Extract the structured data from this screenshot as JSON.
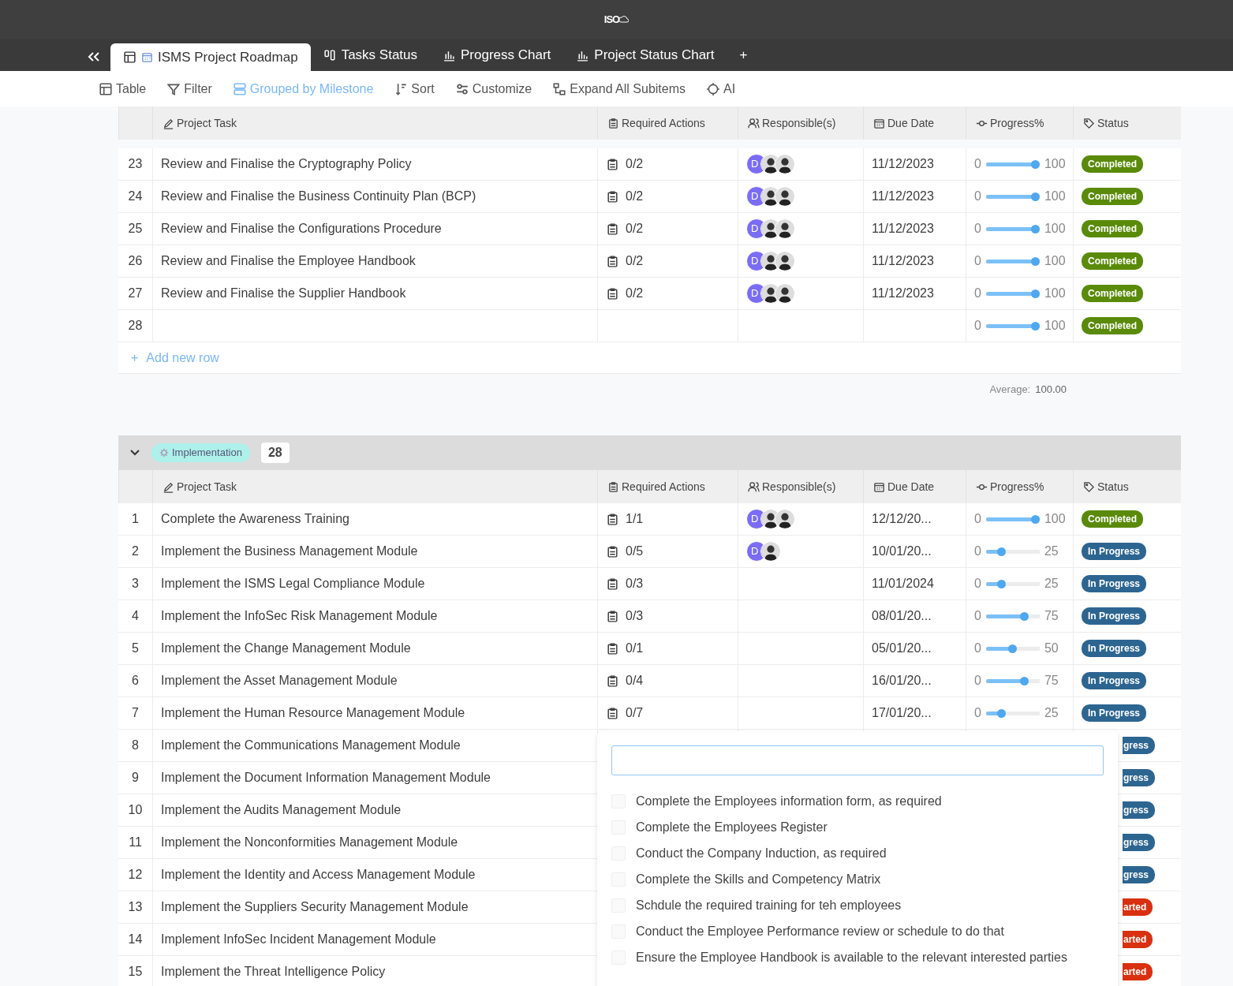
{
  "app": {
    "logo": "ISO"
  },
  "tabs": [
    {
      "label": "ISMS Project Roadmap",
      "selected": true
    },
    {
      "label": "Tasks Status",
      "selected": false
    },
    {
      "label": "Progress Chart",
      "selected": false
    },
    {
      "label": "Project Status Chart",
      "selected": false
    }
  ],
  "add_tab": "+",
  "toolbar": [
    {
      "label": "Table",
      "active": false
    },
    {
      "label": "Filter",
      "active": false
    },
    {
      "label": "Grouped by Milestone",
      "active": true
    },
    {
      "label": "Sort",
      "active": false
    },
    {
      "label": "Customize",
      "active": false
    },
    {
      "label": "Expand All Subitems",
      "active": false
    },
    {
      "label": "AI",
      "active": false
    }
  ],
  "groups": [
    {
      "columns": [
        "Project Task",
        "Required Actions",
        "Responsible(s)",
        "Due Date",
        "Progress%",
        "Status"
      ],
      "rows": [
        {
          "num": "23",
          "task": "Review and Finalise the Cryptography Policy",
          "actions": "0/2",
          "people": [
            {
              "kind": "initials",
              "text": "D"
            },
            {
              "kind": "photo"
            },
            {
              "kind": "photo"
            }
          ],
          "due": "11/12/2023",
          "min": "0",
          "level": 1.0,
          "value": "100",
          "status": {
            "text": "Completed",
            "color": "#5a8a0a",
            "cut": false
          }
        },
        {
          "num": "24",
          "task": "Review and Finalise the Business Continuity Plan (BCP)",
          "actions": "0/2",
          "people": [
            {
              "kind": "initials",
              "text": "D"
            },
            {
              "kind": "photo"
            },
            {
              "kind": "photo"
            }
          ],
          "due": "11/12/2023",
          "min": "0",
          "level": 1.0,
          "value": "100",
          "status": {
            "text": "Completed",
            "color": "#5a8a0a",
            "cut": false
          }
        },
        {
          "num": "25",
          "task": "Review and Finalise the Configurations Procedure",
          "actions": "0/2",
          "people": [
            {
              "kind": "initials",
              "text": "D"
            },
            {
              "kind": "photo"
            },
            {
              "kind": "photo"
            }
          ],
          "due": "11/12/2023",
          "min": "0",
          "level": 1.0,
          "value": "100",
          "status": {
            "text": "Completed",
            "color": "#5a8a0a",
            "cut": false
          }
        },
        {
          "num": "26",
          "task": "Review and Finalise the Employee Handbook",
          "actions": "0/2",
          "people": [
            {
              "kind": "initials",
              "text": "D"
            },
            {
              "kind": "photo"
            },
            {
              "kind": "photo"
            }
          ],
          "due": "11/12/2023",
          "min": "0",
          "level": 1.0,
          "value": "100",
          "status": {
            "text": "Completed",
            "color": "#5a8a0a",
            "cut": false
          }
        },
        {
          "num": "27",
          "task": "Review and Finalise the Supplier Handbook",
          "actions": "0/2",
          "people": [
            {
              "kind": "initials",
              "text": "D"
            },
            {
              "kind": "photo"
            },
            {
              "kind": "photo"
            }
          ],
          "due": "11/12/2023",
          "min": "0",
          "level": 1.0,
          "value": "100",
          "status": {
            "text": "Completed",
            "color": "#5a8a0a",
            "cut": false
          }
        },
        {
          "num": "28",
          "min": "0",
          "level": 1.0,
          "value": "100",
          "status": {
            "text": "Completed",
            "color": "#5a8a0a",
            "cut": false
          }
        }
      ],
      "add_icon": "+",
      "add_row": "Add new row",
      "average_label": "Average:",
      "average": "100.00"
    },
    {
      "label": "Implementation",
      "count": "28",
      "expanded": true,
      "columns": [
        "Project Task",
        "Required Actions",
        "Responsible(s)",
        "Due Date",
        "Progress%",
        "Status"
      ],
      "rows": [
        {
          "num": "1",
          "task": "Complete the Awareness Training",
          "actions": "1/1",
          "people": [
            {
              "kind": "initials",
              "text": "D"
            },
            {
              "kind": "photo"
            },
            {
              "kind": "photo"
            }
          ],
          "due": "12/12/20...",
          "min": "0",
          "level": 1.0,
          "value": "100",
          "status": {
            "text": "Completed",
            "color": "#5a8a0a",
            "cut": false
          }
        },
        {
          "num": "2",
          "task": "Implement the Business Management Module",
          "actions": "0/5",
          "people": [
            {
              "kind": "initials",
              "text": "D"
            },
            {
              "kind": "photo"
            }
          ],
          "due": "10/01/20...",
          "min": "0",
          "level": 0.25,
          "value": "25",
          "status": {
            "text": "In Progress",
            "color": "#2d6591",
            "cut": false
          }
        },
        {
          "num": "3",
          "task": "Implement the ISMS Legal Compliance Module",
          "actions": "0/3",
          "due": "11/01/2024",
          "min": "0",
          "level": 0.25,
          "value": "25",
          "status": {
            "text": "In Progress",
            "color": "#2d6591",
            "cut": false
          }
        },
        {
          "num": "4",
          "task": "Implement the InfoSec Risk Management Module",
          "actions": "0/3",
          "due": "08/01/20...",
          "min": "0",
          "level": 0.75,
          "value": "75",
          "status": {
            "text": "In Progress",
            "color": "#2d6591",
            "cut": false
          }
        },
        {
          "num": "5",
          "task": "Implement the Change Management Module",
          "actions": "0/1",
          "due": "05/01/20...",
          "min": "0",
          "level": 0.5,
          "value": "50",
          "status": {
            "text": "In Progress",
            "color": "#2d6591",
            "cut": false
          }
        },
        {
          "num": "6",
          "task": "Implement the Asset Management Module",
          "actions": "0/4",
          "due": "16/01/20...",
          "min": "0",
          "level": 0.75,
          "value": "75",
          "status": {
            "text": "In Progress",
            "color": "#2d6591",
            "cut": false
          }
        },
        {
          "num": "7",
          "task": "Implement the Human Resource Management Module",
          "actions": "0/7",
          "due": "17/01/20...",
          "min": "0",
          "level": 0.25,
          "value": "25",
          "status": {
            "text": "In Progress",
            "color": "#2d6591",
            "cut": false
          }
        },
        {
          "num": "8",
          "task": "Implement the Communications Management Module",
          "status": {
            "text": "gress",
            "color": "#2d6591",
            "cut": true
          }
        },
        {
          "num": "9",
          "task": "Implement the Document Information Management Module",
          "status": {
            "text": "gress",
            "color": "#2d6591",
            "cut": true
          }
        },
        {
          "num": "10",
          "task": "Implement the Audits Management Module",
          "status": {
            "text": "gress",
            "color": "#2d6591",
            "cut": true
          }
        },
        {
          "num": "11",
          "task": "Implement the Nonconformities Management Module",
          "status": {
            "text": "gress",
            "color": "#2d6591",
            "cut": true
          }
        },
        {
          "num": "12",
          "task": "Implement the Identity and Access Management Module",
          "status": {
            "text": "gress",
            "color": "#2d6591",
            "cut": true
          }
        },
        {
          "num": "13",
          "task": "Implement the Suppliers Security Management Module",
          "status": {
            "text": "arted",
            "color": "#d9300f",
            "cut": true
          }
        },
        {
          "num": "14",
          "task": "Implement InfoSec Incident Management Module",
          "status": {
            "text": "arted",
            "color": "#d9300f",
            "cut": true
          }
        },
        {
          "num": "15",
          "task": "Implement the Threat Intelligence Policy",
          "status": {
            "text": "arted",
            "color": "#d9300f",
            "cut": true
          }
        }
      ]
    }
  ],
  "popup": {
    "items": [
      {
        "label": "Complete the Employees information form, as required",
        "checked": false
      },
      {
        "label": "Complete the Employees Register",
        "checked": false
      },
      {
        "label": "Conduct the Company Induction, as required",
        "checked": false
      },
      {
        "label": "Complete the Skills and Competency Matrix",
        "checked": false
      },
      {
        "label": "Schdule the required training for teh employees",
        "checked": false
      },
      {
        "label": "Conduct the Employee Performance review or schedule to do that",
        "checked": false
      },
      {
        "label": "Ensure the Employee Handbook is available to the relevant interested parties",
        "checked": false
      }
    ]
  }
}
